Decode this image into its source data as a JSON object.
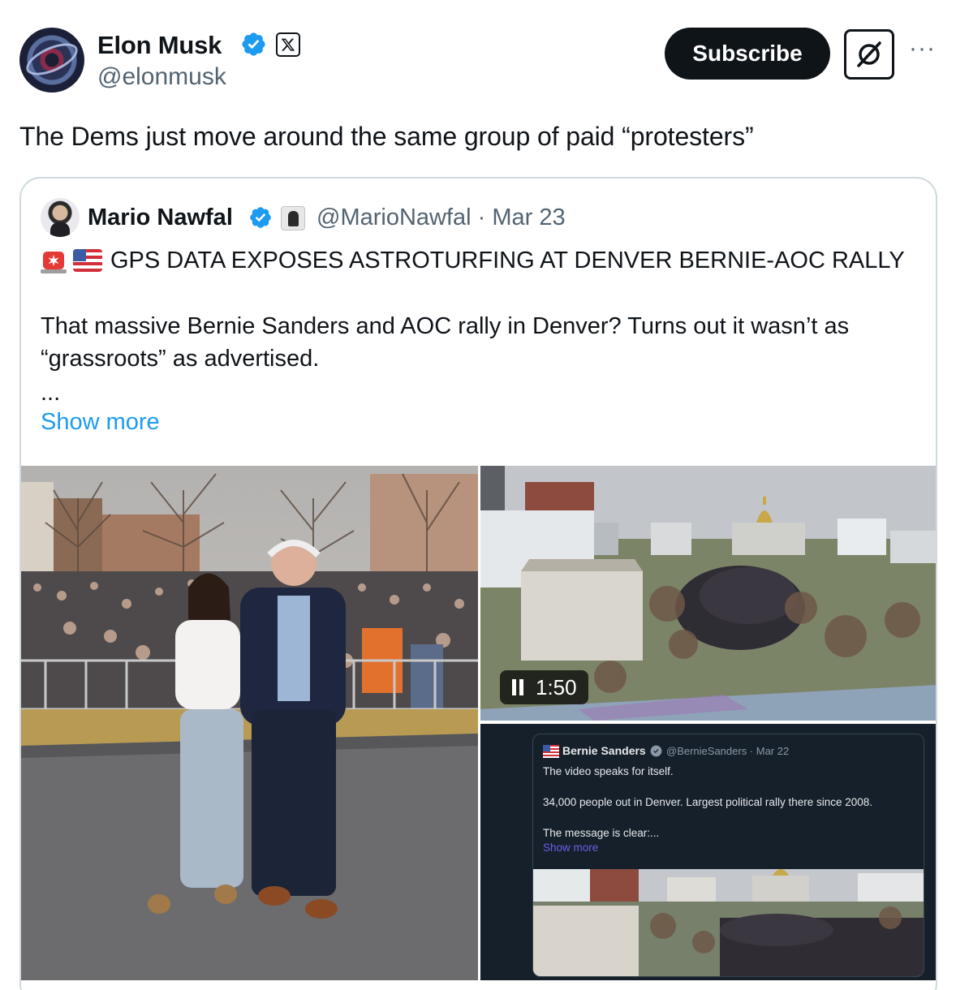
{
  "post": {
    "author_name": "Elon Musk",
    "author_handle": "@elonmusk",
    "subscribe_label": "Subscribe",
    "more_label": "···",
    "text": "The Dems just move around the same group of paid “protesters”"
  },
  "quote": {
    "author_name": "Mario Nawfal",
    "author_handle_date": "@MarioNawfal · Mar 23",
    "headline": "GPS DATA EXPOSES ASTROTURFING AT DENVER BERNIE-AOC RALLY",
    "body": "That massive Bernie Sanders and AOC rally in Denver? Turns out it wasn’t as “grassroots” as advertised.",
    "ellipsis": "...",
    "show_more": "Show more"
  },
  "media": {
    "video_duration": "1:50",
    "embedded_tweet": {
      "author_name": "Bernie Sanders",
      "handle_date": "@BernieSanders · Mar 22",
      "line1": "The video speaks for itself.",
      "line2": "34,000 people out in Denver. Largest political rally there since 2008.",
      "line3": "The message is clear:...",
      "show_more": "Show more"
    }
  },
  "icons": {
    "verified": "verified-badge-icon",
    "x_badge": "x-logo-icon",
    "grok": "grok-icon",
    "siren": "siren-emoji-icon",
    "flag": "us-flag-emoji-icon",
    "pause": "pause-icon"
  },
  "colors": {
    "verified_blue": "#1d9bf0",
    "link_blue": "#1d9bf0",
    "secondary_text": "#536471",
    "border": "#cfd9de",
    "subscribe_bg": "#0f1419"
  }
}
